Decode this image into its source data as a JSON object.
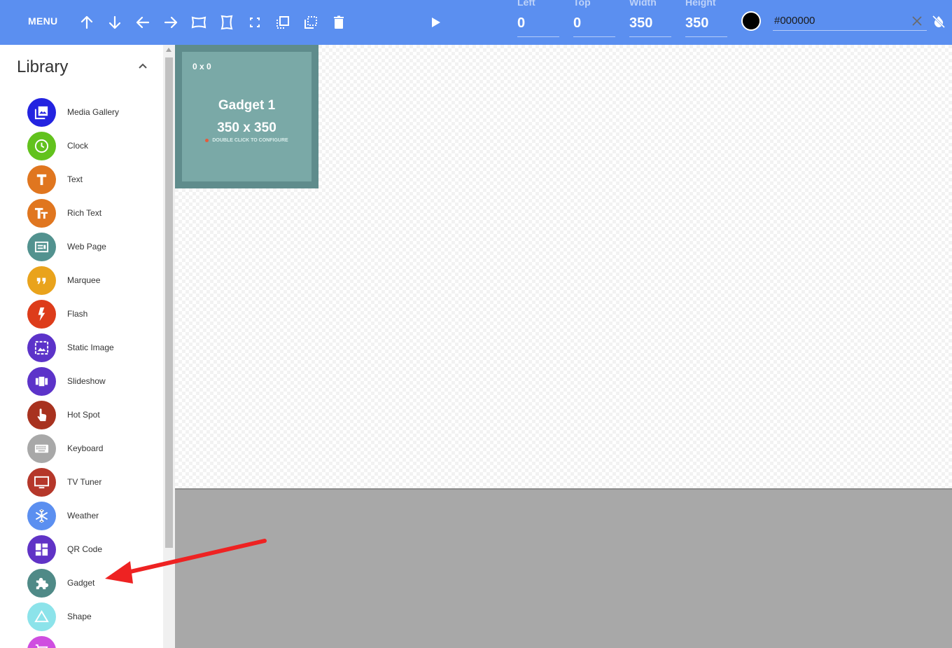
{
  "toolbar": {
    "menu_label": "MENU",
    "icons": [
      "arrow-up-icon",
      "arrow-down-icon",
      "arrow-left-icon",
      "arrow-right-icon",
      "stretch-width-icon",
      "stretch-height-icon",
      "fullscreen-icon",
      "bring-forward-icon",
      "send-backward-icon",
      "trash-icon",
      "play-icon"
    ],
    "fields": [
      {
        "label": "Left",
        "value": "0"
      },
      {
        "label": "Top",
        "value": "0"
      },
      {
        "label": "Width",
        "value": "350"
      },
      {
        "label": "Height",
        "value": "350"
      }
    ],
    "color_value": "#000000",
    "swatch_color": "#000000",
    "accent_color": "#5b8ff0"
  },
  "library": {
    "title": "Library",
    "items": [
      {
        "label": "Media Gallery",
        "icon": "media-gallery-icon",
        "color": "#2323e0"
      },
      {
        "label": "Clock",
        "icon": "clock-icon",
        "color": "#62c21d"
      },
      {
        "label": "Text",
        "icon": "text-icon",
        "color": "#e0761f"
      },
      {
        "label": "Rich Text",
        "icon": "rich-text-icon",
        "color": "#e0761f"
      },
      {
        "label": "Web Page",
        "icon": "web-page-icon",
        "color": "#52928f"
      },
      {
        "label": "Marquee",
        "icon": "quote-icon",
        "color": "#e9a31c"
      },
      {
        "label": "Flash",
        "icon": "flash-icon",
        "color": "#dd3c1a"
      },
      {
        "label": "Static Image",
        "icon": "image-icon",
        "color": "#5c33c9"
      },
      {
        "label": "Slideshow",
        "icon": "slideshow-icon",
        "color": "#5c33c9"
      },
      {
        "label": "Hot Spot",
        "icon": "touch-icon",
        "color": "#a8321f"
      },
      {
        "label": "Keyboard",
        "icon": "keyboard-icon",
        "color": "#a8a8a8"
      },
      {
        "label": "TV Tuner",
        "icon": "tv-icon",
        "color": "#b5372a"
      },
      {
        "label": "Weather",
        "icon": "snowflake-icon",
        "color": "#5b8ff0"
      },
      {
        "label": "QR Code",
        "icon": "dashboard-icon",
        "color": "#6033c6"
      },
      {
        "label": "Gadget",
        "icon": "puzzle-icon",
        "color": "#4f8a87"
      },
      {
        "label": "Shape",
        "icon": "triangle-icon",
        "color": "#8ce3ea"
      },
      {
        "label": "",
        "icon": "shopping-cart-icon",
        "color": "#cf4ee0"
      }
    ]
  },
  "gadget": {
    "position_label": "0 x 0",
    "name": "Gadget 1",
    "size_label": "350 x 350",
    "hint": "DOUBLE CLICK TO CONFIGURE"
  }
}
